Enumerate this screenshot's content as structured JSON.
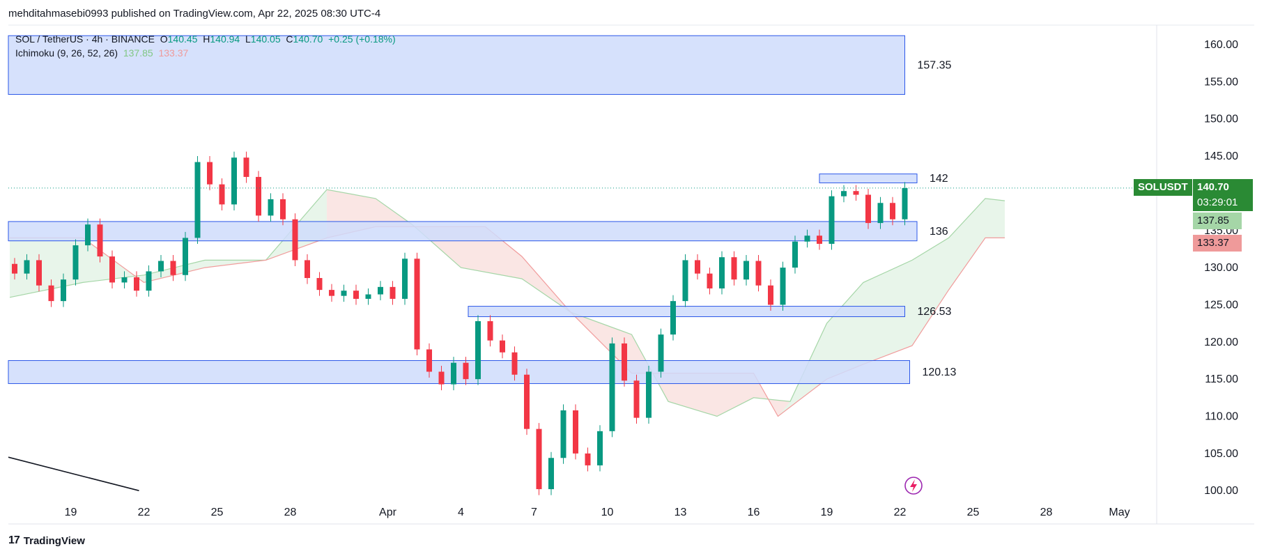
{
  "header": {
    "published_line": "mehditahmasebi0993 published on TradingView.com, Apr 22, 2025 08:30 UTC-4"
  },
  "legend": {
    "symbol_line": "SOL / TetherUS · 4h · BINANCE",
    "ohlc": {
      "o_label": "O",
      "o": "140.45",
      "h_label": "H",
      "h": "140.94",
      "l_label": "L",
      "l": "140.05",
      "c_label": "C",
      "c": "140.70",
      "change": "+0.25 (+0.18%)"
    },
    "indicator": "Ichimoku (9, 26, 52, 26)",
    "indicator_a": "137.85",
    "indicator_b": "133.37"
  },
  "footer": {
    "brand": "TradingView",
    "logo_glyph": "17"
  },
  "colors": {
    "up": "#089981",
    "down": "#f23645",
    "zone_fill": "#cfdcfb",
    "zone_stroke": "#2a56e8",
    "cloud_green": "#e6f4e8",
    "cloud_red": "#fde3e3",
    "span_a": "#a5d6a7",
    "span_b": "#f19c9c",
    "price_tag": "#2a8a34"
  },
  "price_tags": {
    "symbol": "SOLUSDT",
    "last": "140.70",
    "countdown": "03:29:01",
    "span_a": "137.85",
    "span_b": "133.37"
  },
  "chart_data": {
    "type": "candlestick",
    "title": "SOL / TetherUS · 4h · BINANCE",
    "y_ticks": [
      "160.00",
      "155.00",
      "150.00",
      "145.00",
      "140.00",
      "135.00",
      "130.00",
      "125.00",
      "120.00",
      "115.00",
      "110.00",
      "105.00",
      "100.00"
    ],
    "x_ticks": [
      {
        "label": "19",
        "day": 19
      },
      {
        "label": "22",
        "day": 22
      },
      {
        "label": "25",
        "day": 25
      },
      {
        "label": "28",
        "day": 28
      },
      {
        "label": "Apr",
        "day": 32
      },
      {
        "label": "4",
        "day": 35
      },
      {
        "label": "7",
        "day": 38
      },
      {
        "label": "10",
        "day": 41
      },
      {
        "label": "13",
        "day": 44
      },
      {
        "label": "16",
        "day": 47
      },
      {
        "label": "19",
        "day": 50
      },
      {
        "label": "22",
        "day": 53
      },
      {
        "label": "25",
        "day": 56
      },
      {
        "label": "28",
        "day": 59
      },
      {
        "label": "May",
        "day": 62
      }
    ],
    "ylim": [
      98,
      163
    ],
    "xlim_days": [
      16.5,
      63.7
    ],
    "zones": [
      {
        "label": "157.35",
        "top": 161.2,
        "bottom": 153.3,
        "day_start": 16.5,
        "day_end": 53.2
      },
      {
        "label": "142",
        "top": 142.6,
        "bottom": 141.4,
        "day_start": 49.7,
        "day_end": 53.7
      },
      {
        "label": "136",
        "top": 136.2,
        "bottom": 133.6,
        "day_start": 16.5,
        "day_end": 53.7
      },
      {
        "label": "126.53",
        "top": 124.8,
        "bottom": 123.4,
        "day_start": 35.3,
        "day_end": 53.2
      },
      {
        "label": "120.13",
        "top": 117.5,
        "bottom": 114.4,
        "day_start": 16.5,
        "day_end": 53.4
      }
    ],
    "candles": [
      {
        "d": 16.7,
        "o": 130.5,
        "c": 129.2
      },
      {
        "d": 17.2,
        "o": 129.2,
        "c": 131.0
      },
      {
        "d": 17.7,
        "o": 131.0,
        "c": 127.6
      },
      {
        "d": 18.2,
        "o": 127.6,
        "c": 125.5
      },
      {
        "d": 18.7,
        "o": 125.5,
        "c": 128.4
      },
      {
        "d": 19.2,
        "o": 128.4,
        "c": 133.0
      },
      {
        "d": 19.7,
        "o": 133.0,
        "c": 135.8
      },
      {
        "d": 20.2,
        "o": 135.8,
        "c": 131.5
      },
      {
        "d": 20.7,
        "o": 131.5,
        "c": 128.0
      },
      {
        "d": 21.2,
        "o": 128.0,
        "c": 128.7
      },
      {
        "d": 21.7,
        "o": 128.7,
        "c": 126.9
      },
      {
        "d": 22.2,
        "o": 126.9,
        "c": 129.5
      },
      {
        "d": 22.7,
        "o": 129.5,
        "c": 130.9
      },
      {
        "d": 23.2,
        "o": 130.9,
        "c": 129.0
      },
      {
        "d": 23.7,
        "o": 129.0,
        "c": 134.0
      },
      {
        "d": 24.2,
        "o": 134.0,
        "c": 144.2
      },
      {
        "d": 24.7,
        "o": 144.2,
        "c": 141.2
      },
      {
        "d": 25.2,
        "o": 141.2,
        "c": 138.5
      },
      {
        "d": 25.7,
        "o": 138.5,
        "c": 144.8
      },
      {
        "d": 26.2,
        "o": 144.8,
        "c": 142.2
      },
      {
        "d": 26.7,
        "o": 142.2,
        "c": 137.0
      },
      {
        "d": 27.2,
        "o": 137.0,
        "c": 139.2
      },
      {
        "d": 27.7,
        "o": 139.2,
        "c": 136.5
      },
      {
        "d": 28.2,
        "o": 136.5,
        "c": 131.0
      },
      {
        "d": 28.7,
        "o": 131.0,
        "c": 128.6
      },
      {
        "d": 29.2,
        "o": 128.6,
        "c": 127.0
      },
      {
        "d": 29.7,
        "o": 127.0,
        "c": 126.2
      },
      {
        "d": 30.2,
        "o": 126.2,
        "c": 126.9
      },
      {
        "d": 30.7,
        "o": 126.9,
        "c": 125.8
      },
      {
        "d": 31.2,
        "o": 125.8,
        "c": 126.4
      },
      {
        "d": 31.7,
        "o": 126.4,
        "c": 127.4
      },
      {
        "d": 32.2,
        "o": 127.4,
        "c": 125.8
      },
      {
        "d": 32.7,
        "o": 125.8,
        "c": 131.2
      },
      {
        "d": 33.2,
        "o": 131.2,
        "c": 119.0
      },
      {
        "d": 33.7,
        "o": 119.0,
        "c": 116.0
      },
      {
        "d": 34.2,
        "o": 116.0,
        "c": 114.3
      },
      {
        "d": 34.7,
        "o": 114.3,
        "c": 117.2
      },
      {
        "d": 35.2,
        "o": 117.2,
        "c": 115.0
      },
      {
        "d": 35.7,
        "o": 115.0,
        "c": 122.8
      },
      {
        "d": 36.2,
        "o": 122.8,
        "c": 120.2
      },
      {
        "d": 36.7,
        "o": 120.2,
        "c": 118.6
      },
      {
        "d": 37.2,
        "o": 118.6,
        "c": 115.6
      },
      {
        "d": 37.7,
        "o": 115.6,
        "c": 108.3
      },
      {
        "d": 38.2,
        "o": 108.3,
        "c": 100.2
      },
      {
        "d": 38.7,
        "o": 100.2,
        "c": 104.4
      },
      {
        "d": 39.2,
        "o": 104.4,
        "c": 110.8
      },
      {
        "d": 39.7,
        "o": 110.8,
        "c": 105.0
      },
      {
        "d": 40.2,
        "o": 105.0,
        "c": 103.4
      },
      {
        "d": 40.7,
        "o": 103.4,
        "c": 108.0
      },
      {
        "d": 41.2,
        "o": 108.0,
        "c": 119.8
      },
      {
        "d": 41.7,
        "o": 119.8,
        "c": 114.8
      },
      {
        "d": 42.2,
        "o": 114.8,
        "c": 109.8
      },
      {
        "d": 42.7,
        "o": 109.8,
        "c": 116.0
      },
      {
        "d": 43.2,
        "o": 116.0,
        "c": 121.0
      },
      {
        "d": 43.7,
        "o": 121.0,
        "c": 125.5
      },
      {
        "d": 44.2,
        "o": 125.5,
        "c": 131.0
      },
      {
        "d": 44.7,
        "o": 131.0,
        "c": 129.2
      },
      {
        "d": 45.2,
        "o": 129.2,
        "c": 127.2
      },
      {
        "d": 45.7,
        "o": 127.2,
        "c": 131.4
      },
      {
        "d": 46.2,
        "o": 131.4,
        "c": 128.4
      },
      {
        "d": 46.7,
        "o": 128.4,
        "c": 130.9
      },
      {
        "d": 47.2,
        "o": 130.9,
        "c": 127.6
      },
      {
        "d": 47.7,
        "o": 127.6,
        "c": 125.0
      },
      {
        "d": 48.2,
        "o": 125.0,
        "c": 130.0
      },
      {
        "d": 48.7,
        "o": 130.0,
        "c": 133.5
      },
      {
        "d": 49.2,
        "o": 133.5,
        "c": 134.3
      },
      {
        "d": 49.7,
        "o": 134.3,
        "c": 133.2
      },
      {
        "d": 50.2,
        "o": 133.2,
        "c": 139.6
      },
      {
        "d": 50.7,
        "o": 139.6,
        "c": 140.3
      },
      {
        "d": 51.2,
        "o": 140.3,
        "c": 139.8
      },
      {
        "d": 51.7,
        "o": 139.8,
        "c": 136.0
      },
      {
        "d": 52.2,
        "o": 136.0,
        "c": 138.7
      },
      {
        "d": 52.7,
        "o": 138.7,
        "c": 136.5
      },
      {
        "d": 53.2,
        "o": 136.5,
        "c": 140.7
      }
    ],
    "span_a": [
      [
        16.5,
        126.0
      ],
      [
        19.5,
        128.0
      ],
      [
        22,
        129.0
      ],
      [
        24.5,
        131.0
      ],
      [
        27,
        131.0
      ],
      [
        29.5,
        140.5
      ],
      [
        31.5,
        139.3
      ],
      [
        33,
        135.8
      ],
      [
        35,
        130.0
      ],
      [
        37.5,
        128.5
      ],
      [
        39.5,
        124.0
      ],
      [
        42,
        121.0
      ],
      [
        43.5,
        112.0
      ],
      [
        45.5,
        110.0
      ],
      [
        47,
        112.5
      ],
      [
        48.5,
        112.0
      ],
      [
        50,
        122.5
      ],
      [
        51.5,
        128.0
      ],
      [
        53.5,
        131.0
      ],
      [
        55,
        134.0
      ],
      [
        56.5,
        139.3
      ],
      [
        57.3,
        139.0
      ]
    ],
    "span_b": [
      [
        16.5,
        134.0
      ],
      [
        19.5,
        134.0
      ],
      [
        22,
        128.0
      ],
      [
        24.5,
        130.0
      ],
      [
        27,
        131.0
      ],
      [
        29.5,
        134.0
      ],
      [
        31.5,
        135.5
      ],
      [
        34,
        135.5
      ],
      [
        36,
        135.5
      ],
      [
        37.5,
        131.5
      ],
      [
        39.5,
        124.0
      ],
      [
        42,
        115.8
      ],
      [
        44.5,
        115.8
      ],
      [
        47,
        115.8
      ],
      [
        48,
        110.0
      ],
      [
        50,
        115.0
      ],
      [
        51.5,
        117.0
      ],
      [
        53.5,
        119.5
      ],
      [
        55,
        127.0
      ],
      [
        56.5,
        134.0
      ],
      [
        57.3,
        134.0
      ]
    ],
    "price_line": 140.7,
    "trendline": {
      "from": [
        16.5,
        104.5
      ],
      "to": [
        21.8,
        100.0
      ]
    }
  }
}
